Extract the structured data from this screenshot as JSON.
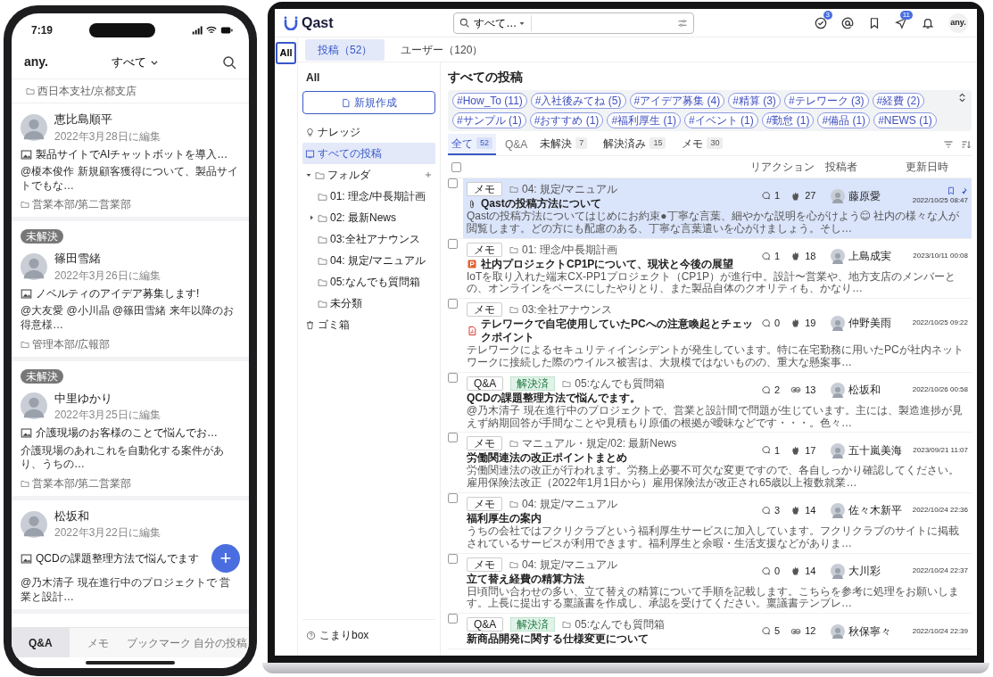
{
  "phone": {
    "time": "7:19",
    "logo": "any.",
    "filter": "すべて",
    "top_folder": "西日本支社/京都支店",
    "posts": [
      {
        "author": "恵比島順平",
        "edited": "2022年3月28日に編集",
        "title": "製品サイトでAIチャットボットを導入…",
        "excerpt": "@榎本俊作 新規顧客獲得について、製品サイトでもな…",
        "folder": "営業本部/第二営業部"
      },
      {
        "badge": "未解決",
        "author": "篠田雪緒",
        "edited": "2022年3月26日に編集",
        "title": "ノベルティのアイデア募集します!",
        "excerpt": "@大友愛 @小川晶 @篠田雪緒 来年以降のお得意様…",
        "folder": "管理本部/広報部"
      },
      {
        "badge": "未解決",
        "author": "中里ゆかり",
        "edited": "2022年3月25日に編集",
        "title": "介護現場のお客様のことで悩んでお…",
        "excerpt": "介護現場のあれこれを自動化する案件があり、うちの…",
        "folder": "営業本部/第二営業部"
      },
      {
        "author": "松坂和",
        "edited": "2022年3月22日に編集",
        "title": "QCDの課題整理方法で悩んでます",
        "excerpt": "@乃木清子 現在進行中のプロジェクトで 営業と設計…"
      }
    ],
    "fab": "+",
    "tabs": [
      {
        "label": "Q&A",
        "selected": true
      },
      {
        "label": "メモ",
        "selected": false
      },
      {
        "label": "ブックマーク",
        "selected": false
      },
      {
        "label": "自分の投稿",
        "selected": false
      }
    ]
  },
  "app": {
    "logo": "Qast",
    "search_scope": "すべて…",
    "header_icons": [
      {
        "kind": "check",
        "badge": "3"
      },
      {
        "kind": "mention"
      },
      {
        "kind": "bookmark"
      },
      {
        "kind": "send",
        "badge": "11"
      },
      {
        "kind": "bell"
      }
    ],
    "user": "any.",
    "rail": [
      {
        "label": "All",
        "selected": true
      }
    ],
    "top_tabs": [
      {
        "label": "投稿（52）",
        "selected": true
      },
      {
        "label": "ユーザー（120）",
        "selected": false
      }
    ],
    "sidebar": {
      "heading": "All",
      "new_button": "新規作成",
      "items": [
        {
          "kind": "knowledge",
          "label": "ナレッジ",
          "selected": false
        },
        {
          "kind": "all",
          "label": "すべての投稿",
          "selected": true
        },
        {
          "kind": "folders",
          "label": "フォルダ",
          "selected": false,
          "expanded": true,
          "children": [
            {
              "label": "01: 理念/中長期計画",
              "collapsed": false
            },
            {
              "label": "02: 最新News",
              "collapsed": true
            },
            {
              "label": "03:全社アナウンス",
              "collapsed": false
            },
            {
              "label": "04: 規定/マニュアル",
              "collapsed": false
            },
            {
              "label": "05:なんでも質問箱",
              "collapsed": false
            },
            {
              "label": "未分類",
              "collapsed": false
            }
          ]
        },
        {
          "kind": "trash",
          "label": "ゴミ箱",
          "selected": false
        }
      ],
      "footer": "こまりbox"
    },
    "title": "すべての投稿",
    "tags": [
      "#How_To (11)",
      "#入社後みてね (5)",
      "#アイデア募集 (4)",
      "#精算 (3)",
      "#テレワーク (3)",
      "#経費 (2)",
      "#サンプル (1)",
      "#おすすめ (1)",
      "#福利厚生 (1)",
      "#イベント (1)",
      "#勤怠 (1)",
      "#備品 (1)",
      "#NEWS (1)"
    ],
    "filters": [
      {
        "kind": "tab",
        "label": "全て",
        "count": "52",
        "selected": true
      },
      {
        "kind": "caption",
        "label": "Q&A"
      },
      {
        "kind": "tab",
        "label": "未解決",
        "count": "7",
        "selected": false
      },
      {
        "kind": "tab",
        "label": "解決済み",
        "count": "15",
        "selected": false
      },
      {
        "kind": "tab",
        "label": "メモ",
        "count": "30",
        "selected": false
      }
    ],
    "header_checked": false,
    "columns": [
      "リアクション",
      "投稿者",
      "更新日時"
    ],
    "posts": [
      {
        "type": "メモ",
        "folder": "04: 規定/マニュアル",
        "attachment": {
          "kind": "clip"
        },
        "title": "Qastの投稿方法について",
        "excerpt": "Qastの投稿方法についてはじめにお約束●丁寧な言葉、細やかな説明を心がけよう😊 社内の様々な人が閲覧します。どの方にも配慮のある、丁寧な言葉遣いを心がけましょう。そし…",
        "comments": "1",
        "reaction": {
          "kind": "clap",
          "count": "27"
        },
        "author": "藤原愛",
        "updated": "2022/10/25 08:47",
        "selected": true,
        "checked": false,
        "pinned": true
      },
      {
        "type": "メモ",
        "folder": "01: 理念/中長期計画",
        "attachment": {
          "kind": "ppt"
        },
        "title": "社内プロジェクトCP1Pについて、現状と今後の展望",
        "excerpt": "IoTを取り入れた端末CX-PP1プロジェクト（CP1P）が進行中。設計〜営業や、地方支店のメンバーとの、オンラインをベースにしたやりとり、また製品自体のクオリティも、かなり…",
        "comments": "1",
        "reaction": {
          "kind": "clap",
          "count": "18"
        },
        "author": "上島成実",
        "updated": "2023/10/11 00:08",
        "selected": false,
        "checked": false,
        "pinned": false
      },
      {
        "type": "メモ",
        "folder": "03:全社アナウンス",
        "attachment": {
          "kind": "pdf"
        },
        "title": "テレワークで自宅使用していたPCへの注意喚起とチェックポイント",
        "excerpt": "テレワークによるセキュリティインシデントが発生しています。特に在宅勤務に用いたPCが社内ネットワークに接続した際のウイルス被害は、大規模ではないものの、重大な懸案事…",
        "comments": "0",
        "reaction": {
          "kind": "clap",
          "count": "19"
        },
        "author": "仲野美雨",
        "updated": "2022/10/25 09:22",
        "selected": false,
        "checked": false,
        "pinned": false
      },
      {
        "type": "Q&A",
        "status": "解決済",
        "folder": "05:なんでも質問箱",
        "title": "QCDの課題整理方法で悩んでます。",
        "excerpt": "@乃木清子 現在進行中のプロジェクトで、営業と設計間で問題が生じています。主には、製造進捗が見えず納期回答が手間なことや見積もり原価の根拠が曖昧などです・・・。色々…",
        "comments": "2",
        "reaction": {
          "kind": "eyes",
          "count": "13"
        },
        "author": "松坂和",
        "updated": "2022/10/26 00:58",
        "selected": false,
        "checked": false,
        "pinned": false
      },
      {
        "type": "メモ",
        "folder": "マニュアル・規定/02: 最新News",
        "title": "労働関連法の改正ポイントまとめ",
        "excerpt": "労働関連法の改正が行われます。労務上必要不可欠な変更ですので、各自しっかり確認してください。雇用保険法改正（2022年1月1日から）雇用保険法が改正され65歳以上複数就業…",
        "comments": "1",
        "reaction": {
          "kind": "clap",
          "count": "17"
        },
        "author": "五十嵐美海",
        "updated": "2023/09/21 11:07",
        "selected": false,
        "checked": false,
        "pinned": false
      },
      {
        "type": "メモ",
        "folder": "04: 規定/マニュアル",
        "title": "福利厚生の案内",
        "excerpt": "うちの会社ではフクリクラブという福利厚生サービスに加入しています。フクリクラブのサイトに掲載されているサービスが利用できます。福利厚生と余暇・生活支援などがありま…",
        "comments": "3",
        "reaction": {
          "kind": "clap",
          "count": "14"
        },
        "author": "佐々木新平",
        "updated": "2022/10/24 22:36",
        "selected": false,
        "checked": false,
        "pinned": false
      },
      {
        "type": "メモ",
        "folder": "04: 規定/マニュアル",
        "title": "立て替え経費の精算方法",
        "excerpt": "日頃問い合わせの多い、立て替えの精算について手順を記載します。こちらを参考に処理をお願いします。上長に提出する稟議書を作成し、承認を受けてください。稟議書テンプレ…",
        "comments": "0",
        "reaction": {
          "kind": "clap",
          "count": "14"
        },
        "author": "大川彩",
        "updated": "2022/10/24 22:37",
        "selected": false,
        "checked": false,
        "pinned": false
      },
      {
        "type": "Q&A",
        "status": "解決済",
        "folder": "05:なんでも質問箱",
        "title": "新商品開発に関する仕様変更について",
        "comments": "5",
        "reaction": {
          "kind": "eyes",
          "count": "12"
        },
        "author": "秋保寧々",
        "updated": "2022/10/24 22:39",
        "selected": false,
        "checked": false,
        "pinned": false
      }
    ]
  }
}
